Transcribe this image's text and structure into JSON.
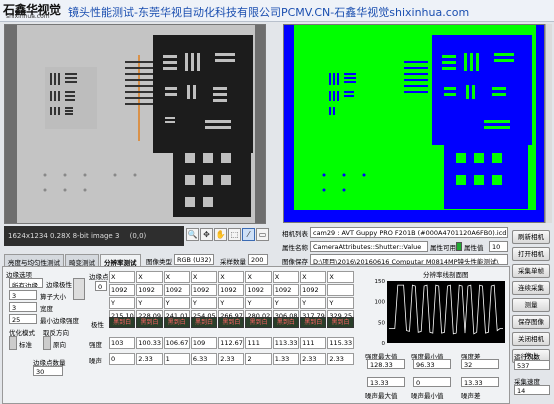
{
  "banner": {
    "logo": "石鑫华视觉",
    "logo_sub": "shixinhua.com",
    "title": "镜头性能测试-东莞华视自动化科技有限公司PCMV.CN-石鑫华视觉shixinhua.com"
  },
  "image_status": {
    "text": "1624x1234 0.28X 8-bit image 3",
    "coords": "(0,0)"
  },
  "camera": {
    "list_label": "相机列表",
    "list_value": "cam29 : AVT Guppy PRO F201B (#000A4701120A6FB0).icd",
    "attr_name_label": "属性名称",
    "attr_name_value": "CameraAttributes::Shutter::Value",
    "attr_avail_label": "属性可用",
    "attr_value_label": "属性值",
    "attr_value": "10",
    "image_type_label": "图像类型",
    "image_type_value": "RGB (U32)",
    "sample_count_label": "采样数量",
    "sample_count_value": "200",
    "save_label": "图像保存",
    "save_path": "D:\\项目\\2016\\20160616 Computar M0814MP镜头性能测试\\"
  },
  "tabs": [
    "亮度与均匀性测试",
    "畸变测试",
    "分辨率测试",
    "图像类型"
  ],
  "edge": {
    "section_label": "边缘选项",
    "mode": "所有边缘",
    "polarity_label": "边缘极性",
    "kernel_value": "3",
    "kernel_label": "算子大小",
    "width_value": "3",
    "width_label": "宽度",
    "min_strength_value": "25",
    "min_strength_label": "最小边缘强度",
    "optimize_label": "优化模式",
    "optimize_value": "标准",
    "reverse_label": "取反方向",
    "reverse_value": "原向",
    "count_label": "边缘点数量",
    "count_value": "30"
  },
  "table": {
    "edge_label": "边缘点",
    "x_label": "X",
    "y_label": "Y",
    "x_values": [
      "1092",
      "1092",
      "1092",
      "1092",
      "1092",
      "1092",
      "1092",
      "1092"
    ],
    "y_values": [
      "215.10",
      "228.09",
      "241.01",
      "254.05",
      "266.97",
      "280.02",
      "306.08",
      "317.79",
      "329.25"
    ],
    "polarity_label": "极性",
    "polarity_values": [
      "黑到白",
      "黑到白",
      "黑到白",
      "黑到白",
      "黑到白",
      "黑到白",
      "黑到白",
      "黑到白",
      "黑到白"
    ],
    "strength_label": "强度",
    "strength_values": [
      "103",
      "100.33",
      "106.67",
      "109",
      "112.67",
      "111",
      "113.33",
      "111",
      "115.33"
    ],
    "noise_label": "噪声",
    "noise_values": [
      "0",
      "2.33",
      "1",
      "6.33",
      "2.33",
      "2",
      "1.33",
      "2.33",
      "2.33"
    ]
  },
  "chart": {
    "title": "分辨率线剖面图",
    "y_ticks": [
      "150",
      "100",
      "50",
      "0"
    ]
  },
  "chart_data": {
    "type": "line",
    "title": "分辨率线剖面图",
    "ylim": [
      0,
      150
    ],
    "y_ticks": [
      150,
      100,
      50,
      0
    ],
    "series": [
      {
        "values": [
          35,
          35,
          35,
          140,
          140,
          140,
          30,
          28,
          140,
          138,
          26,
          28,
          138,
          140,
          26,
          24,
          140,
          138,
          24,
          26,
          138,
          140,
          22,
          24,
          140,
          138,
          24,
          138,
          140,
          22,
          26,
          140,
          138,
          24,
          26,
          138,
          140,
          30,
          35,
          35
        ]
      }
    ]
  },
  "stats": {
    "max_label": "强度最大值",
    "max_value": "128.33",
    "min_label": "强度最小值",
    "min_value": "96.33",
    "diff_label": "强度差",
    "diff_value": "32",
    "noise_max_label": "噪声最大值",
    "noise_max_value": "13.33",
    "noise_min_label": "噪声最小值",
    "noise_min_value": "0",
    "noise_diff_label": "噪声差",
    "noise_diff_value": "13.33"
  },
  "right_panel": {
    "buttons": [
      "刷新相机",
      "打开相机",
      "采集单帧",
      "连续采集",
      "测量",
      "保存图像",
      "关闭相机",
      "停止"
    ],
    "run_count_label": "运行次数",
    "run_count_value": "537",
    "speed_label": "采集速度",
    "speed_value": "14"
  },
  "colors": {
    "banner_title": "#1b4fb0",
    "green_bg": "#00ff00",
    "blue_block": "#0000ff"
  }
}
